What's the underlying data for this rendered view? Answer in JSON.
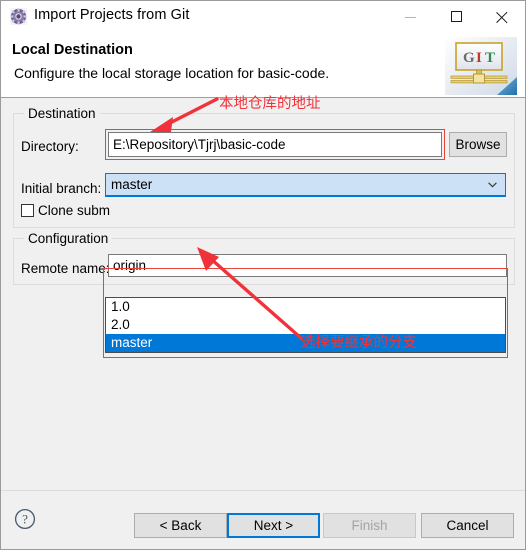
{
  "window": {
    "title": "Import Projects from Git",
    "icon": "eclipse-gear-icon",
    "controls": {
      "minimize": "minimize-icon",
      "maximize": "maximize-icon",
      "close": "close-icon"
    }
  },
  "header": {
    "title": "Local Destination",
    "description": "Configure the local storage location for basic-code.",
    "logo_text": "GIT",
    "logo_letters": [
      "G",
      "I",
      "T"
    ]
  },
  "destination": {
    "group_label": "Destination",
    "directory_label": "Directory:",
    "directory_value": "E:\\Repository\\Tjrj\\basic-code",
    "browse_label": "Browse",
    "branch_label": "Initial branch:",
    "branch_value": "master",
    "clone_submodules_label": "Clone subm",
    "clone_submodules_checked": false
  },
  "branch_dropdown": {
    "options": [
      "1.0",
      "2.0",
      "master"
    ],
    "selected": "master",
    "selected_index": 2
  },
  "configuration": {
    "group_label": "Configuration",
    "remote_label": "Remote name:",
    "remote_value": "origin"
  },
  "annotations": [
    {
      "text": "本地仓库的地址",
      "target": "directory-field"
    },
    {
      "text": "选择要继承的分支",
      "target": "branch-dropdown-master"
    }
  ],
  "footer": {
    "help_icon": "help-icon",
    "back_label": "< Back",
    "next_label": "Next >",
    "finish_label": "Finish",
    "cancel_label": "Cancel",
    "finish_disabled": true,
    "next_focused": true
  },
  "colors": {
    "accent": "#0078d7",
    "annotation_red": "#f0333a",
    "highlight_red": "#e8443a",
    "combo_fill": "#cce1f5",
    "dialog_bg": "#f0f0f0"
  }
}
